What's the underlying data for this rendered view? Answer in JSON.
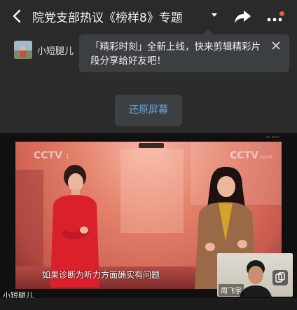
{
  "header": {
    "title": "院党支部热议《榜样8》专题",
    "back_icon": "back-chevron-icon",
    "share_icon": "share-arrow-icon",
    "more_icon": "more-dots-icon",
    "notification_color": "#f25a3a"
  },
  "host": {
    "name": "小短腿儿"
  },
  "tooltip": {
    "text": "「精彩时刻」全新上线，快来剪辑精彩片段分享给好友吧！",
    "close_icon": "close-icon"
  },
  "restore_button": {
    "label": "还原屏幕",
    "color": "#5fa8e8"
  },
  "video": {
    "channel_logo": "CCTV",
    "channel_num": "1",
    "channel_logo_right": "CCTV",
    "channel_domain": ".com",
    "subtitle": "如果诊断为听力方面确实有问题",
    "watermark": "小短腿儿"
  },
  "pip": {
    "name": "周飞宇",
    "switch_icon": "switch-camera-icon"
  }
}
